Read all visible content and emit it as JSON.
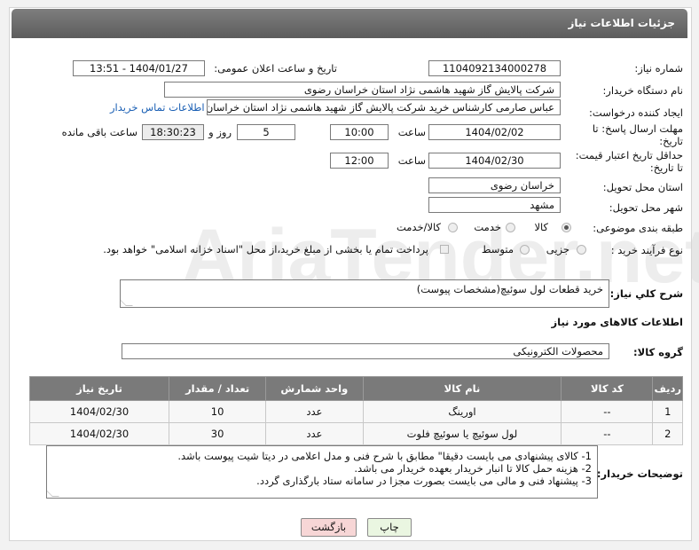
{
  "header": {
    "title": "جزئیات اطلاعات نیاز"
  },
  "fields": {
    "need_number_label": "شماره نیاز:",
    "need_number": "1104092134000278",
    "announce_label": "تاریخ و ساعت اعلان عمومی:",
    "announce_value": "1404/01/27 - 13:51",
    "buyer_org_label": "نام دستگاه خریدار:",
    "buyer_org": "شرکت پالایش گاز شهید هاشمی نژاد   استان خراسان رضوی",
    "requester_label": "ایجاد کننده درخواست:",
    "requester": "عباس صارمی کارشناس خرید  شرکت پالایش گاز شهید هاشمی نژاد   استان خراسان رضوی",
    "contact_link": "اطلاعات تماس خریدار",
    "deadline_label_1": "مهلت ارسال پاسخ: تا",
    "deadline_label_2": "تاریخ:",
    "deadline_date": "1404/02/02",
    "time_label": "ساعت",
    "deadline_time": "10:00",
    "days_value": "5",
    "days_label": "روز و",
    "remaining_time": "18:30:23",
    "remaining_label": "ساعت باقی مانده",
    "validity_label_1": "حداقل تاریخ اعتبار قیمت:",
    "validity_label_2": "تا تاریخ:",
    "validity_date": "1404/02/30",
    "validity_time": "12:00",
    "province_label": "استان محل تحویل:",
    "province": "خراسان رضوی",
    "city_label": "شهر محل تحویل:",
    "city": "مشهد",
    "category_label": "طبقه بندی موضوعی:",
    "category_options": [
      "کالا",
      "خدمت",
      "کالا/خدمت"
    ],
    "process_label": "نوع فرآیند خرید :",
    "process_options": [
      "جزیی",
      "متوسط"
    ],
    "payment_note": "پرداخت تمام یا بخشی از مبلغ خرید،از محل \"اسناد خزانه اسلامی\" خواهد بود."
  },
  "description": {
    "label": "شرح کلي نياز:",
    "value": "خرید قطعات لول سوئیچ(مشخصات پیوست)"
  },
  "goods_section": {
    "title": "اطلاعات کالاهای مورد نیاز",
    "group_label": "گروه کالا:",
    "group_value": "محصولات الکترونیکی"
  },
  "table": {
    "headers": [
      "ردیف",
      "کد کالا",
      "نام کالا",
      "واحد شمارش",
      "تعداد / مقدار",
      "تاریخ نیاز"
    ],
    "rows": [
      [
        "1",
        "--",
        "اورینگ",
        "عدد",
        "10",
        "1404/02/30"
      ],
      [
        "2",
        "--",
        "لول سوئیچ یا سوئیچ فلوت",
        "عدد",
        "30",
        "1404/02/30"
      ]
    ]
  },
  "notes": {
    "label": "توضیحات خریدار:",
    "lines": [
      "1-    کالای پیشنهادی می بایست دقیقا\" مطابق با شرح فنی و مدل اعلامی در دیتا شیت پیوست باشد.",
      "2-    هزینه حمل کالا تا انبار خریدار بعهده خریدار می باشد.",
      "3-    پیشنهاد فنی و مالی می بایست بصورت مجزا در سامانه ستاد بارگذاری گردد."
    ]
  },
  "buttons": {
    "print": "چاپ",
    "back": "بازگشت"
  },
  "watermark": "AriaTender.net",
  "colors": {
    "header": "#6b6b6b",
    "link": "#1a5fb4",
    "back_button": "#f7d6d6",
    "print_button": "#eaf6e1"
  }
}
